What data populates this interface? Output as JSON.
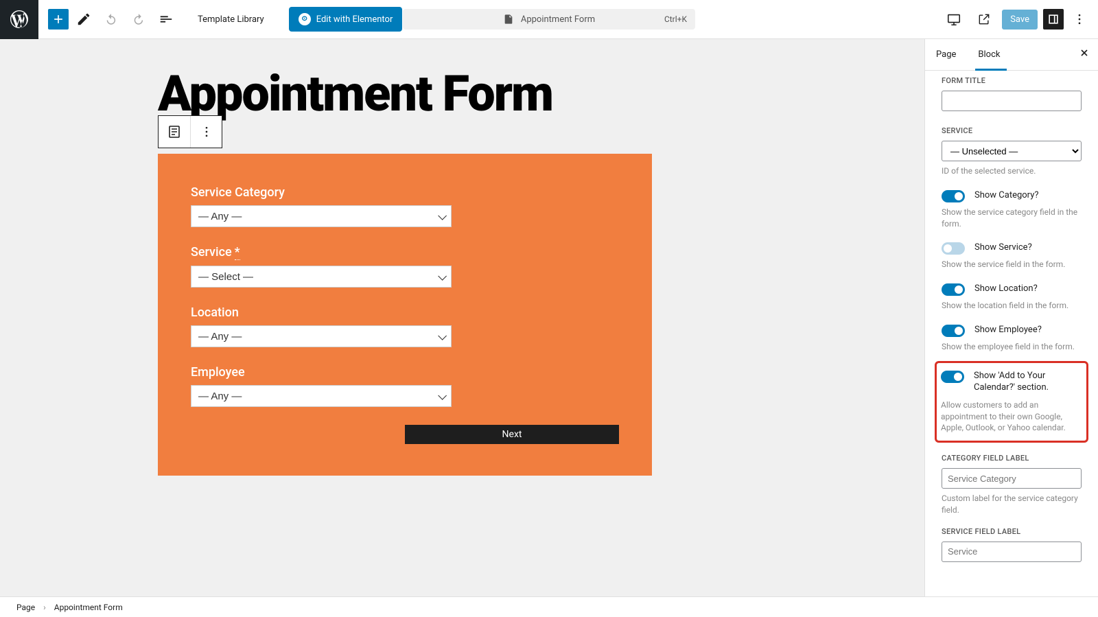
{
  "toolbar": {
    "template_library": "Template Library",
    "elementor_btn": "Edit with Elementor",
    "search_title": "Appointment Form",
    "search_kbd": "Ctrl+K",
    "save": "Save"
  },
  "page": {
    "title": "Appointment Form"
  },
  "form": {
    "fields": [
      {
        "label": "Service Category",
        "value": "— Any —",
        "required": false
      },
      {
        "label": "Service",
        "value": "— Select —",
        "required": true
      },
      {
        "label": "Location",
        "value": "— Any —",
        "required": false
      },
      {
        "label": "Employee",
        "value": "— Any —",
        "required": false
      }
    ],
    "next_btn": "Next"
  },
  "sidebar": {
    "tabs": {
      "page": "Page",
      "block": "Block"
    },
    "form_title_label": "FORM TITLE",
    "form_title_value": "",
    "service_label": "SERVICE",
    "service_value": "— Unselected —",
    "service_help": "ID of the selected service.",
    "toggles": [
      {
        "label": "Show Category?",
        "on": true,
        "help": "Show the service category field in the form."
      },
      {
        "label": "Show Service?",
        "on": false,
        "help": "Show the service field in the form."
      },
      {
        "label": "Show Location?",
        "on": true,
        "help": "Show the location field in the form."
      },
      {
        "label": "Show Employee?",
        "on": true,
        "help": "Show the employee field in the form."
      }
    ],
    "highlighted": {
      "label": "Show 'Add to Your Calendar?' section.",
      "on": true,
      "help": "Allow customers to add an appointment to their own Google, Apple, Outlook, or Yahoo calendar."
    },
    "category_field_label": "CATEGORY FIELD LABEL",
    "category_field_placeholder": "Service Category",
    "category_field_help": "Custom label for the service category field.",
    "service_field_label": "SERVICE FIELD LABEL",
    "service_field_placeholder": "Service"
  },
  "breadcrumb": {
    "root": "Page",
    "current": "Appointment Form"
  }
}
